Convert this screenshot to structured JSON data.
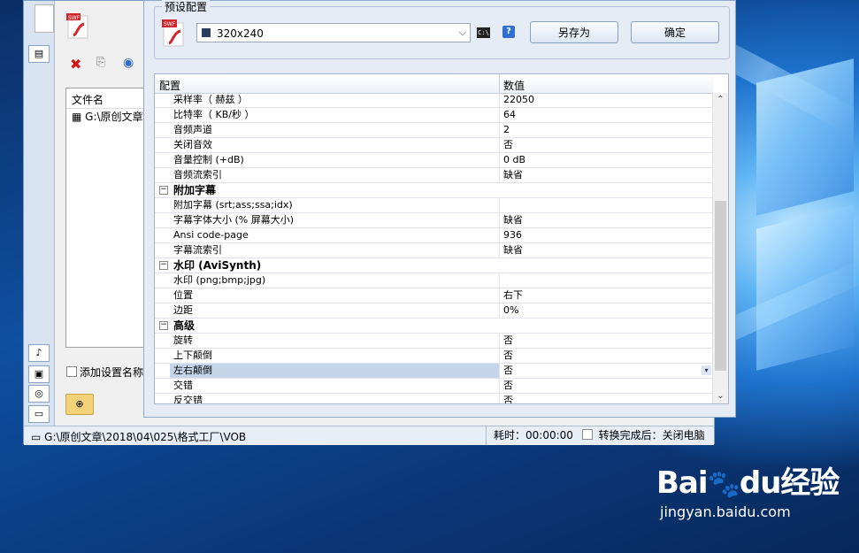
{
  "app": {
    "file_list_header": "文件名",
    "file_item": "G:\\原创文章\\",
    "add_setting_name_label": "添加设置名称",
    "status_path": "G:\\原创文章\\2018\\04\\025\\格式工厂\\VOB",
    "status_time": "耗时：00:00:00",
    "status_after": "转换完成后：关闭电脑"
  },
  "dialog": {
    "group_title": "预设配置",
    "preset_value": "320x240",
    "save_as_label": "另存为",
    "ok_label": "确定",
    "cmd_icon_text": "C:\\",
    "help_icon_text": "?"
  },
  "grid": {
    "col_config": "配置",
    "col_value": "数值",
    "rows": [
      {
        "type": "item",
        "key": "采样率（ 赫兹 ）",
        "value": "22050"
      },
      {
        "type": "item",
        "key": "比特率（ KB/秒 ）",
        "value": "64"
      },
      {
        "type": "item",
        "key": "音频声道",
        "value": "2"
      },
      {
        "type": "item",
        "key": "关闭音效",
        "value": "否"
      },
      {
        "type": "item",
        "key": "音量控制 (+dB)",
        "value": "0 dB"
      },
      {
        "type": "item",
        "key": "音频流索引",
        "value": "缺省"
      },
      {
        "type": "cat",
        "key": "附加字幕",
        "value": ""
      },
      {
        "type": "item",
        "key": "附加字幕 (srt;ass;ssa;idx)",
        "value": ""
      },
      {
        "type": "item",
        "key": "字幕字体大小 (% 屏幕大小)",
        "value": "缺省"
      },
      {
        "type": "item",
        "key": "Ansi code-page",
        "value": "936"
      },
      {
        "type": "item",
        "key": "字幕流索引",
        "value": "缺省"
      },
      {
        "type": "cat",
        "key": "水印 (AviSynth)",
        "value": ""
      },
      {
        "type": "item",
        "key": "水印 (png;bmp;jpg)",
        "value": ""
      },
      {
        "type": "item",
        "key": "位置",
        "value": "右下"
      },
      {
        "type": "item",
        "key": "边距",
        "value": "0%"
      },
      {
        "type": "cat",
        "key": "高级",
        "value": ""
      },
      {
        "type": "item",
        "key": "旋转",
        "value": "否"
      },
      {
        "type": "item",
        "key": "上下颠倒",
        "value": "否"
      },
      {
        "type": "sel",
        "key": "左右颠倒",
        "value": "否"
      },
      {
        "type": "item",
        "key": "交错",
        "value": "否"
      },
      {
        "type": "item",
        "key": "反交错",
        "value": "否"
      }
    ]
  },
  "watermark": {
    "brand_a": "Bai",
    "brand_b": "du",
    "brand_c": "经验",
    "url": "jingyan.baidu.com"
  },
  "icons": {
    "swf": "swf-icon",
    "delete": "delete-icon",
    "clear": "clear-icon",
    "play": "play-icon",
    "folder": "folder-icon",
    "expand": "collapse-icon"
  }
}
